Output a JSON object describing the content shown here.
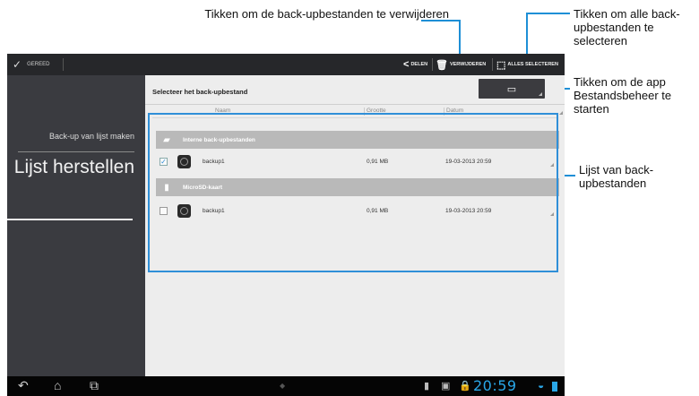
{
  "callouts": {
    "delete": "Tikken om de back-upbestanden te verwijderen",
    "select_all": "Tikken om alle back-upbestanden te selecteren",
    "file_manager": "Tikken om de app Bestandsbeheer te starten",
    "list": "Lijst van back-upbestanden"
  },
  "actionbar": {
    "done": "GEREED",
    "share": "DELEN",
    "delete": "VERWIJDEREN",
    "select_all": "ALLES SELECTEREN"
  },
  "left": {
    "item1": "Back-up van lijst maken",
    "item2": "Lijst herstellen"
  },
  "main": {
    "title": "Selecteer het back-upbestand",
    "columns": [
      "Naam",
      "Grootte",
      "Datum"
    ],
    "groups": [
      {
        "label": "Interne back-upbestanden",
        "icon": "folder-icon",
        "files": [
          {
            "name": "backup1",
            "size": "0,91 MB",
            "date": "19-03-2013 20:59",
            "checked": true
          }
        ]
      },
      {
        "label": "MicroSD-kaart",
        "icon": "sdcard-icon",
        "files": [
          {
            "name": "backup1",
            "size": "0,91 MB",
            "date": "19-03-2013 20:59",
            "checked": false
          }
        ]
      }
    ]
  },
  "statusbar": {
    "time": "20:59"
  },
  "colors": {
    "accent": "#2f8fd8",
    "clock": "#2aa7e8",
    "actionbar": "#26272a"
  }
}
